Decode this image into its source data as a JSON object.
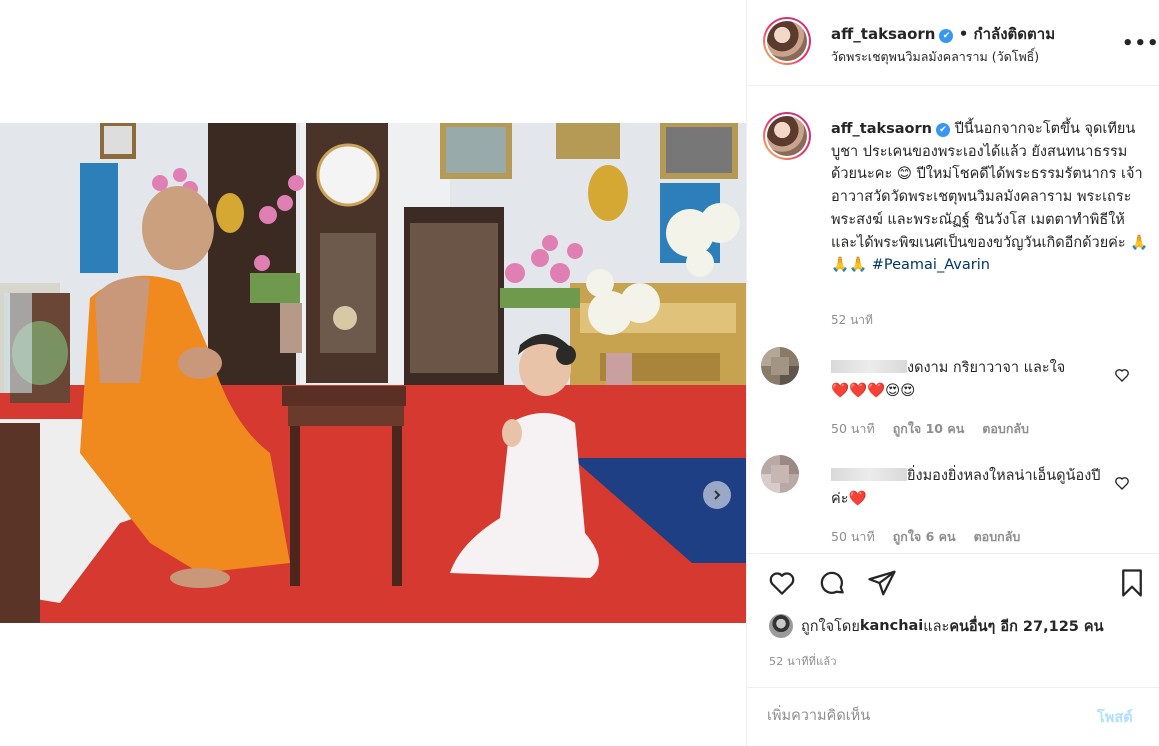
{
  "post": {
    "username": "aff_taksaorn",
    "follow_status": "• กำลังติดตาม",
    "location": "วัดพระเชตุพนวิมลมังคลาราม (วัดโพธิ์)",
    "more_icon": "more-horizontal-icon"
  },
  "caption": {
    "username": "aff_taksaorn",
    "text": "ปีนี้นอกจากจะโตขึ้น จุดเทียนบูชา ประเคนของพระเองได้แล้ว ยังสนทนาธรรมด้วยนะคะ 😊 ปีใหม่โชคดีได้พระธรรมรัตนากร เจ้าอาวาสวัดวัดพระเชตุพนวิมลมังคลาราม พระเถระ พระสงฆ์ และพระณัฏฐ์ ชินวังโส เมตตาทำพิธีให้ และได้พระพิฆเนศเป็นของขวัญวันเกิดอีกด้วยค่ะ 🙏🙏🙏 ",
    "hashtag": "#Peamai_Avarin",
    "time": "52 นาที"
  },
  "comments": [
    {
      "text": "งดงาม กริยาวาจา และใจ",
      "emojis": "❤️❤️❤️😍😍",
      "time": "50 นาที",
      "likes": "ถูกใจ 10 คน",
      "reply": "ตอบกลับ"
    },
    {
      "text": "ยิ่งมองยิ่งหลงใหลน่าเอ็นดูน้องปีค่ะ❤️",
      "time": "50 นาที",
      "likes": "ถูกใจ 6 คน",
      "reply": "ตอบกลับ"
    }
  ],
  "likes": {
    "prefix": "ถูกใจโดย ",
    "user": "kanchai",
    "middle": " และ ",
    "others": "คนอื่นๆ อีก 27,125 คน"
  },
  "post_time": "52 นาทีที่แล้ว",
  "add_comment": {
    "placeholder": "เพิ่มความคิดเห็น",
    "post_label": "โพสต์"
  },
  "colors": {
    "link": "#00376b",
    "secondary": "#8e8e8e",
    "post_button_disabled": "#b2dffc",
    "verified": "#3897f0"
  }
}
